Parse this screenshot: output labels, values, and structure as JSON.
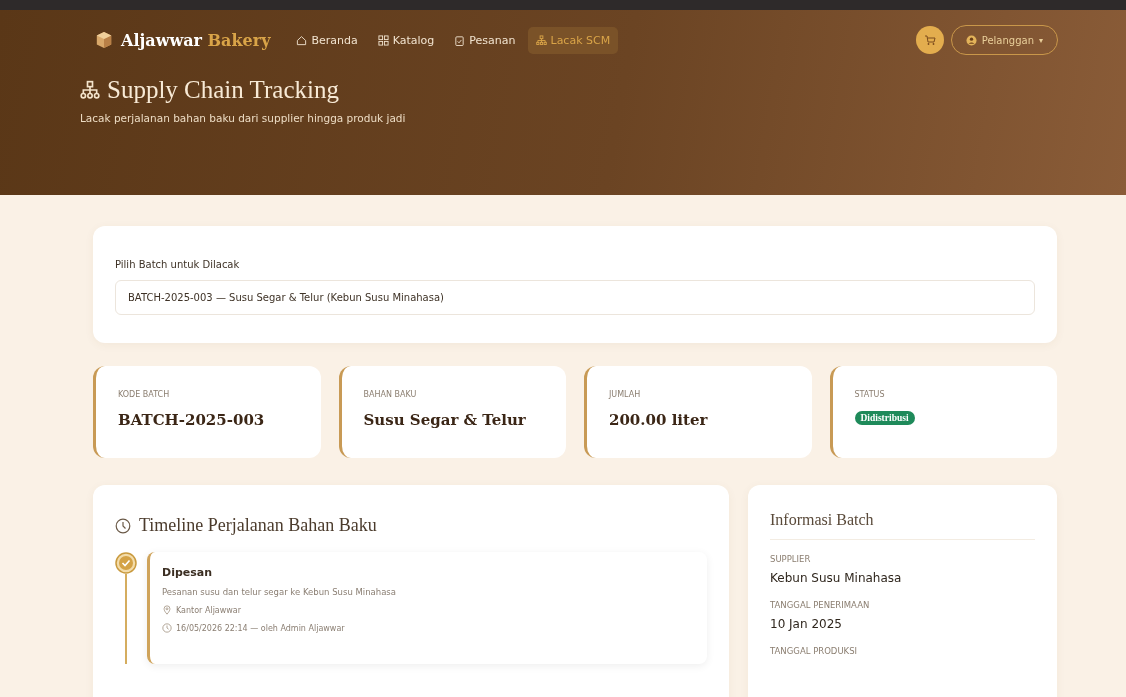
{
  "brand": {
    "name": "Aljawwar",
    "accent": "Bakery"
  },
  "nav": [
    {
      "label": "Beranda",
      "kind": "home",
      "selected": false
    },
    {
      "label": "Katalog",
      "kind": "grid",
      "selected": false
    },
    {
      "label": "Pesanan",
      "kind": "orders",
      "selected": false
    },
    {
      "label": "Lacak SCM",
      "kind": "tracking",
      "selected": true
    }
  ],
  "user_menu": {
    "label": "Pelanggan",
    "caret": "▾"
  },
  "hero": {
    "title": "Supply Chain Tracking",
    "subtitle": "Lacak perjalanan bahan baku dari supplier hingga produk jadi"
  },
  "batch_select": {
    "label": "Pilih Batch untuk Dilacak",
    "value": "BATCH-2025-003 — Susu Segar & Telur (Kebun Susu Minahasa)"
  },
  "stats": [
    {
      "label": "KODE BATCH",
      "value": "BATCH-2025-003",
      "kind": "text"
    },
    {
      "label": "BAHAN BAKU",
      "value": "Susu Segar & Telur",
      "kind": "text"
    },
    {
      "label": "JUMLAH",
      "value": "200.00 liter",
      "kind": "text"
    },
    {
      "label": "STATUS",
      "value": "Didistribusi",
      "kind": "badge",
      "color": "#1e8a5a"
    }
  ],
  "timeline": {
    "title": "Timeline Perjalanan Bahan Baku",
    "steps": [
      {
        "title": "Dipesan",
        "description": "Pesanan susu dan telur segar ke Kebun Susu Minahasa",
        "location": "Kantor Aljawwar",
        "time": "16/05/2026 22:14 — oleh Admin Aljawwar",
        "done": true
      }
    ]
  },
  "info": {
    "title": "Informasi Batch",
    "fields": [
      {
        "label": "SUPPLIER",
        "value": "Kebun Susu Minahasa"
      },
      {
        "label": "TANGGAL PENERIMAAN",
        "value": "10 Jan 2025"
      },
      {
        "label": "TANGGAL PRODUKSI"
      }
    ]
  }
}
